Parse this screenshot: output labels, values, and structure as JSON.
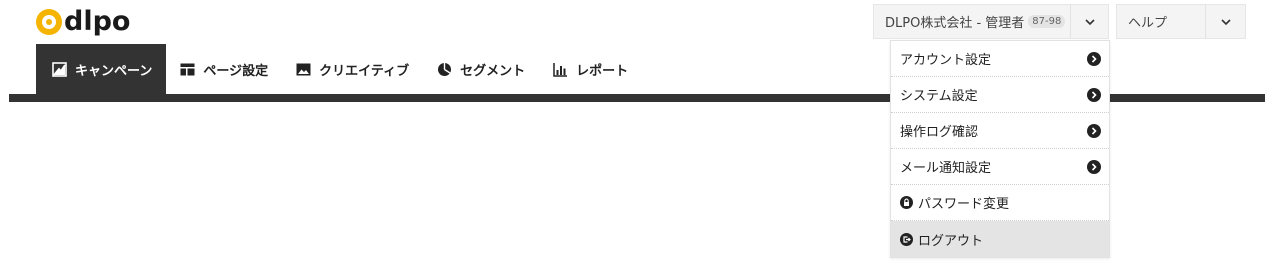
{
  "logo": {
    "text": "dlpo"
  },
  "account": {
    "label": "DLPO株式会社 - 管理者",
    "id": "87-98"
  },
  "help": {
    "label": "ヘルプ"
  },
  "nav": {
    "items": [
      {
        "label": "キャンペーン",
        "icon": "campaign-icon",
        "active": true
      },
      {
        "label": "ページ設定",
        "icon": "layout-icon"
      },
      {
        "label": "クリエイティブ",
        "icon": "image-icon"
      },
      {
        "label": "セグメント",
        "icon": "pie-chart-icon"
      },
      {
        "label": "レポート",
        "icon": "bar-chart-icon"
      }
    ]
  },
  "menu": {
    "items": [
      {
        "label": "アカウント設定",
        "icon": "chevron-right-circle-icon"
      },
      {
        "label": "システム設定",
        "icon": "chevron-right-circle-icon"
      },
      {
        "label": "操作ログ確認",
        "icon": "chevron-right-circle-icon"
      },
      {
        "label": "メール通知設定",
        "icon": "chevron-right-circle-icon"
      },
      {
        "label": "パスワード変更",
        "icon": "lock-icon"
      },
      {
        "label": "ログアウト",
        "icon": "logout-icon"
      }
    ]
  },
  "colors": {
    "accent": "#f5b400",
    "dark": "#333333",
    "menu_highlight": "#e4e4e4"
  }
}
